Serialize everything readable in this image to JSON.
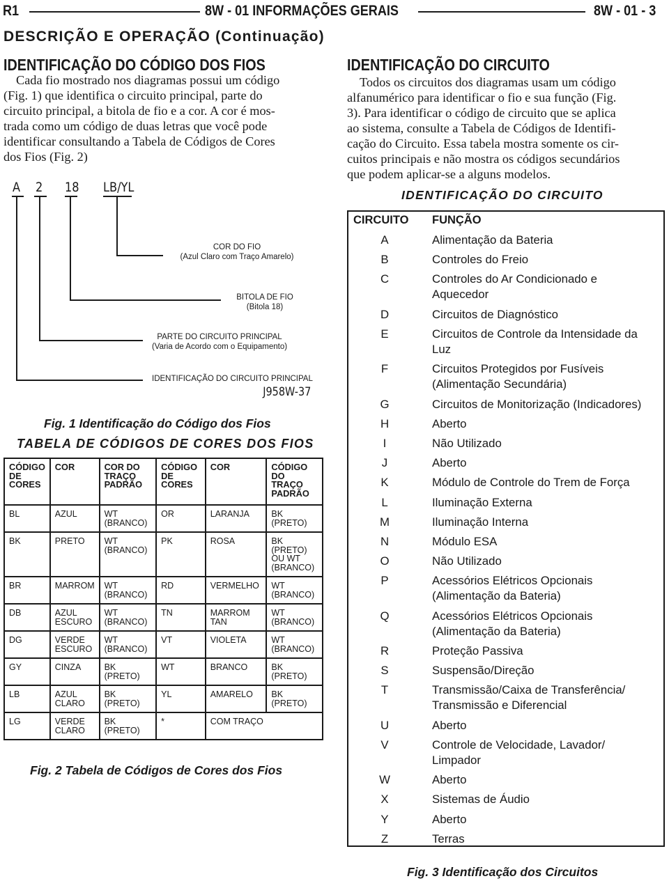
{
  "header": {
    "left": "R1",
    "center": "8W - 01 INFORMAÇÕES GERAIS",
    "right": "8W - 01 - 3"
  },
  "section_title": "DESCRIÇÃO E OPERAÇÃO (Continuação)",
  "left_column": {
    "heading": "IDENTIFICAÇÃO DO CÓDIGO DOS FIOS",
    "paragraph_lines": [
      "Cada fio mostrado nos diagramas possui um código",
      "(Fig. 1) que identifica o circuito principal, parte do",
      "circuito principal, a bitola de fio e a cor. A cor é mos-",
      "trada como um código de duas letras que você pode",
      "identificar consultando a Tabela de Códigos de Cores",
      "dos Fios (Fig. 2)"
    ],
    "figure1": {
      "codes": [
        "A",
        "2",
        "18",
        "LB/YL"
      ],
      "labels": [
        {
          "title": "COR DO FIO",
          "subtitle": "(Azul Claro com Traço Amarelo)"
        },
        {
          "title": "BITOLA DE FIO",
          "subtitle": "(Bitola 18)"
        },
        {
          "title": "PARTE DO CIRCUITO PRINCIPAL",
          "subtitle": "(Varia de Acordo com o Equipamento)"
        },
        {
          "title": "IDENTIFICAÇÃO DO CIRCUITO PRINCIPAL",
          "subtitle": ""
        }
      ],
      "reference": "J958W-37",
      "caption": "Fig. 1 Identificação do Código dos Fios"
    },
    "color_table": {
      "title": "TABELA DE CÓDIGOS DE CORES DOS FIOS",
      "headers": [
        "CÓDIGO\nDE\nCORES",
        "COR",
        "COR DO\nTRAÇO\nPADRÃO",
        "CÓDIGO\nDE\nCORES",
        "COR",
        "CÓDIGO\nDO\nTRAÇO\nPADRÃO"
      ],
      "rows": [
        [
          "BL",
          "AZUL",
          "WT\n(BRANCO)",
          "OR",
          "LARANJA",
          "BK\n(PRETO)"
        ],
        [
          "BK",
          "PRETO",
          "WT\n(BRANCO)",
          "PK",
          "ROSA",
          "BK\n(PRETO)\nOU WT\n(BRANCO)"
        ],
        [
          "BR",
          "MARROM",
          "WT\n(BRANCO)",
          "RD",
          "VERMELHO",
          "WT\n(BRANCO)"
        ],
        [
          "DB",
          "AZUL\nESCURO",
          "WT\n(BRANCO)",
          "TN",
          "MARROM\nTAN",
          "WT\n(BRANCO)"
        ],
        [
          "DG",
          "VERDE\nESCURO",
          "WT\n(BRANCO)",
          "VT",
          "VIOLETA",
          "WT\n(BRANCO)"
        ],
        [
          "GY",
          "CINZA",
          "BK\n(PRETO)",
          "WT",
          "BRANCO",
          "BK\n(PRETO)"
        ],
        [
          "LB",
          "AZUL\nCLARO",
          "BK\n(PRETO)",
          "YL",
          "AMARELO",
          "BK\n(PRETO)"
        ],
        [
          "LG",
          "VERDE\nCLARO",
          "BK\n(PRETO)",
          "*",
          "COM TRAÇO",
          ""
        ]
      ],
      "caption": "Fig. 2 Tabela de Códigos de Cores dos Fios"
    }
  },
  "right_column": {
    "heading": "IDENTIFICAÇÃO DO CIRCUITO",
    "paragraph_lines": [
      "Todos os circuitos dos diagramas usam um código",
      "alfanumérico para identificar o fio e sua função (Fig.",
      "3). Para identificar o código de circuito que se aplica",
      "ao sistema, consulte a Tabela de Códigos de Identifi-",
      "cação do Circuito. Essa tabela mostra somente os cir-",
      "cuitos principais e não mostra os códigos secundários",
      "que podem aplicar-se a alguns modelos."
    ],
    "circuit_table": {
      "title": "IDENTIFICAÇÃO DO CIRCUITO",
      "headers": [
        "CIRCUITO",
        "FUNÇÃO"
      ],
      "rows": [
        {
          "code": "A",
          "function": "Alimentação da Bateria"
        },
        {
          "code": "B",
          "function": "Controles do Freio"
        },
        {
          "code": "C",
          "function": "Controles do Ar Condicionado e\nAquecedor"
        },
        {
          "code": "D",
          "function": "Circuitos de Diagnóstico"
        },
        {
          "code": "E",
          "function": "Circuitos de Controle da Intensidade da\nLuz"
        },
        {
          "code": "F",
          "function": "Circuitos Protegidos por Fusíveis\n(Alimentação Secundária)"
        },
        {
          "code": "G",
          "function": "Circuitos de Monitorização (Indicadores)"
        },
        {
          "code": "H",
          "function": "Aberto"
        },
        {
          "code": "I",
          "function": "Não Utilizado"
        },
        {
          "code": "J",
          "function": "Aberto"
        },
        {
          "code": "K",
          "function": "Módulo de Controle do Trem de Força"
        },
        {
          "code": "L",
          "function": "Iluminação Externa"
        },
        {
          "code": "M",
          "function": "Iluminação Interna"
        },
        {
          "code": "N",
          "function": "Módulo ESA"
        },
        {
          "code": "O",
          "function": "Não Utilizado"
        },
        {
          "code": "P",
          "function": "Acessórios Elétricos Opcionais\n(Alimentação da Bateria)"
        },
        {
          "code": "Q",
          "function": "Acessórios Elétricos Opcionais\n(Alimentação da Bateria)"
        },
        {
          "code": "R",
          "function": "Proteção Passiva"
        },
        {
          "code": "S",
          "function": "Suspensão/Direção"
        },
        {
          "code": "T",
          "function": "Transmissão/Caixa de Transferência/\nTransmissão e Diferencial"
        },
        {
          "code": "U",
          "function": "Aberto"
        },
        {
          "code": "V",
          "function": "Controle de Velocidade, Lavador/\nLimpador"
        },
        {
          "code": "W",
          "function": "Aberto"
        },
        {
          "code": "X",
          "function": "Sistemas de Áudio"
        },
        {
          "code": "Y",
          "function": "Aberto"
        },
        {
          "code": "Z",
          "function": "Terras"
        }
      ],
      "caption": "Fig. 3 Identificação dos Circuitos"
    }
  }
}
